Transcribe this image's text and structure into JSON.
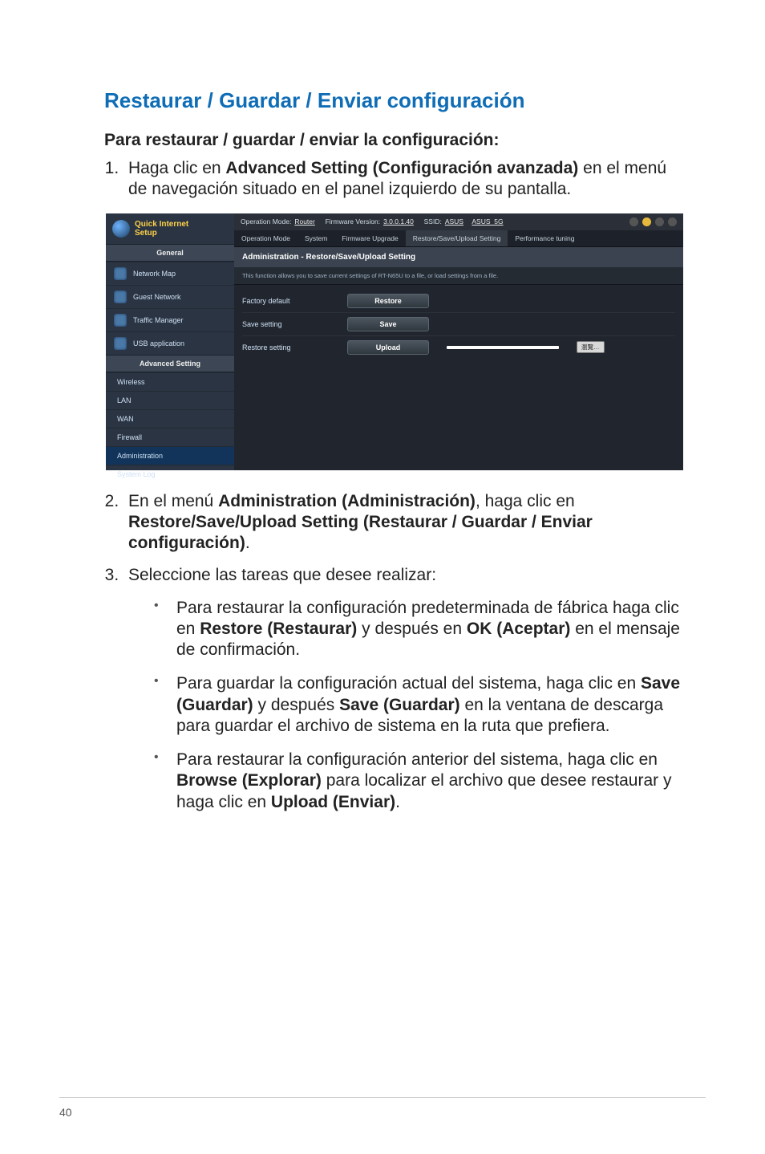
{
  "page_number": "40",
  "heading": "Restaurar / Guardar / Enviar configuración",
  "subheading": "Para restaurar / guardar / enviar la configuración:",
  "step1": {
    "pre": "Haga clic en ",
    "bold": "Advanced Setting (Configuración avanzada)",
    "post": " en el menú de navegación situado en el panel izquierdo de su pantalla."
  },
  "step2": {
    "pre": "En el menú ",
    "bold1": "Administration (Administración)",
    "mid": ", haga clic en ",
    "bold2": "Restore/Save/Upload Setting (Restaurar / Guardar / Enviar configuración)",
    "post": "."
  },
  "step3": {
    "text": "Seleccione las tareas que desee realizar:",
    "b1": {
      "pre": "Para restaurar la configuración predeterminada de fábrica haga clic en ",
      "bold1": "Restore (Restaurar)",
      "mid": " y después en ",
      "bold2": "OK (Aceptar)",
      "post": " en el mensaje de confirmación."
    },
    "b2": {
      "pre": "Para guardar la configuración actual del sistema, haga clic en ",
      "bold1": "Save (Guardar)",
      "mid": " y después ",
      "bold2": "Save (Guardar)",
      "post": " en la ventana de descarga para guardar el archivo de sistema en la ruta que prefiera."
    },
    "b3": {
      "pre": "Para restaurar la configuración anterior del sistema, haga clic en ",
      "bold1": "Browse (Explorar)",
      "mid": " para localizar el archivo que desee restaurar y haga clic en ",
      "bold2": "Upload (Enviar)",
      "post": "."
    }
  },
  "router": {
    "qis_line1": "Quick Internet",
    "qis_line2": "Setup",
    "section_general": "General",
    "section_advanced": "Advanced Setting",
    "nav": {
      "netmap": "Network Map",
      "guest": "Guest Network",
      "traffic": "Traffic Manager",
      "usb": "USB application",
      "wireless": "Wireless",
      "lan": "LAN",
      "wan": "WAN",
      "firewall": "Firewall",
      "admin": "Administration",
      "syslog": "System Log"
    },
    "topbar": {
      "opmode_lbl": "Operation Mode:",
      "opmode_val": "Router",
      "fw_lbl": "Firmware Version:",
      "fw_val": "3.0.0.1.40",
      "ssid_lbl": "SSID:",
      "ssid1": "ASUS",
      "ssid2": "ASUS_5G"
    },
    "tabs": {
      "t1": "Operation Mode",
      "t2": "System",
      "t3": "Firmware Upgrade",
      "t4": "Restore/Save/Upload Setting",
      "t5": "Performance tuning"
    },
    "panel": {
      "title": "Administration - Restore/Save/Upload Setting",
      "desc": "This function allows you to save current settings of RT-N65U to a file, or load settings from a file.",
      "r1_label": "Factory default",
      "r1_btn": "Restore",
      "r2_label": "Save setting",
      "r2_btn": "Save",
      "r3_label": "Restore setting",
      "r3_btn": "Upload",
      "browse": "瀏覽…"
    }
  }
}
